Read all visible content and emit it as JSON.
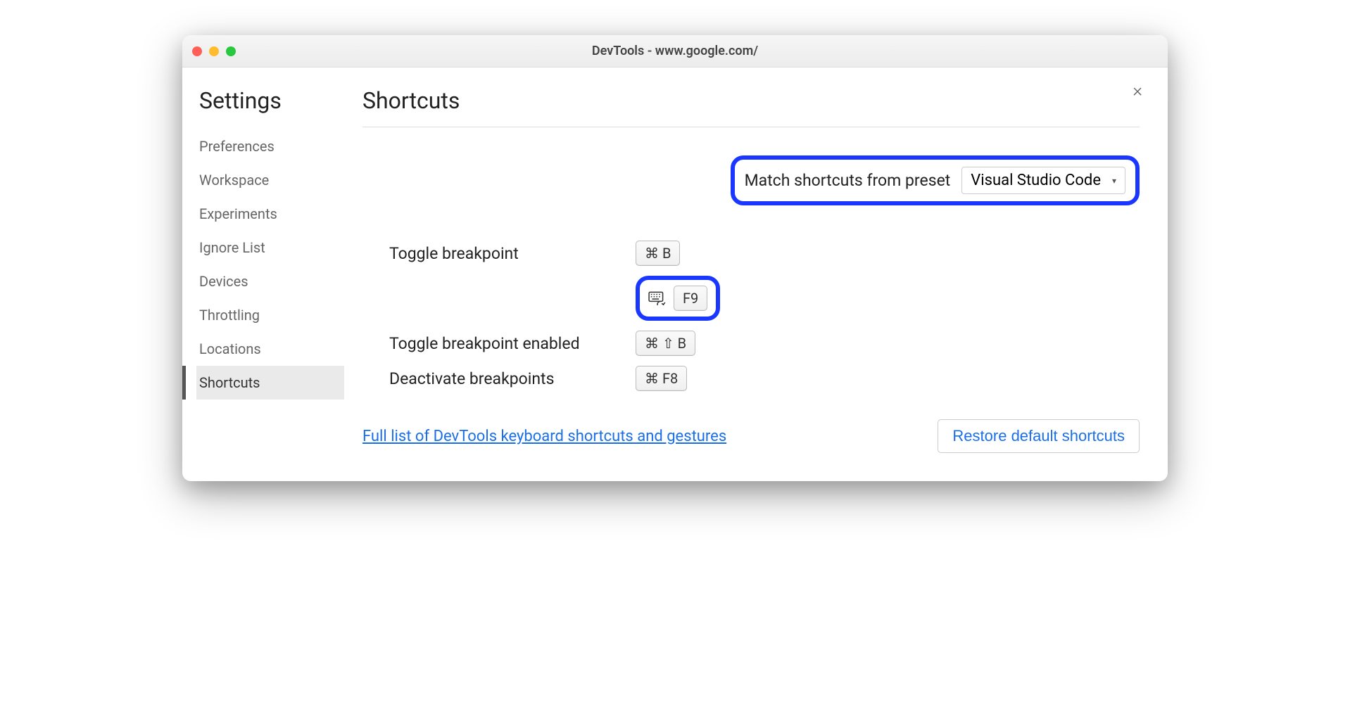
{
  "window": {
    "title": "DevTools - www.google.com/"
  },
  "sidebar": {
    "title": "Settings",
    "items": [
      {
        "label": "Preferences",
        "selected": false
      },
      {
        "label": "Workspace",
        "selected": false
      },
      {
        "label": "Experiments",
        "selected": false
      },
      {
        "label": "Ignore List",
        "selected": false
      },
      {
        "label": "Devices",
        "selected": false
      },
      {
        "label": "Throttling",
        "selected": false
      },
      {
        "label": "Locations",
        "selected": false
      },
      {
        "label": "Shortcuts",
        "selected": true
      }
    ]
  },
  "main": {
    "title": "Shortcuts",
    "preset": {
      "label": "Match shortcuts from preset",
      "value": "Visual Studio Code"
    },
    "shortcuts": [
      {
        "label": "Toggle breakpoint",
        "keys": "⌘ B"
      },
      {
        "label": "",
        "keys": "F9",
        "highlighted": true,
        "has_keyboard_icon": true
      },
      {
        "label": "Toggle breakpoint enabled",
        "keys": "⌘ ⇧ B"
      },
      {
        "label": "Deactivate breakpoints",
        "keys": "⌘ F8"
      }
    ],
    "footer": {
      "link": "Full list of DevTools keyboard shortcuts and gestures",
      "restore": "Restore default shortcuts"
    }
  }
}
